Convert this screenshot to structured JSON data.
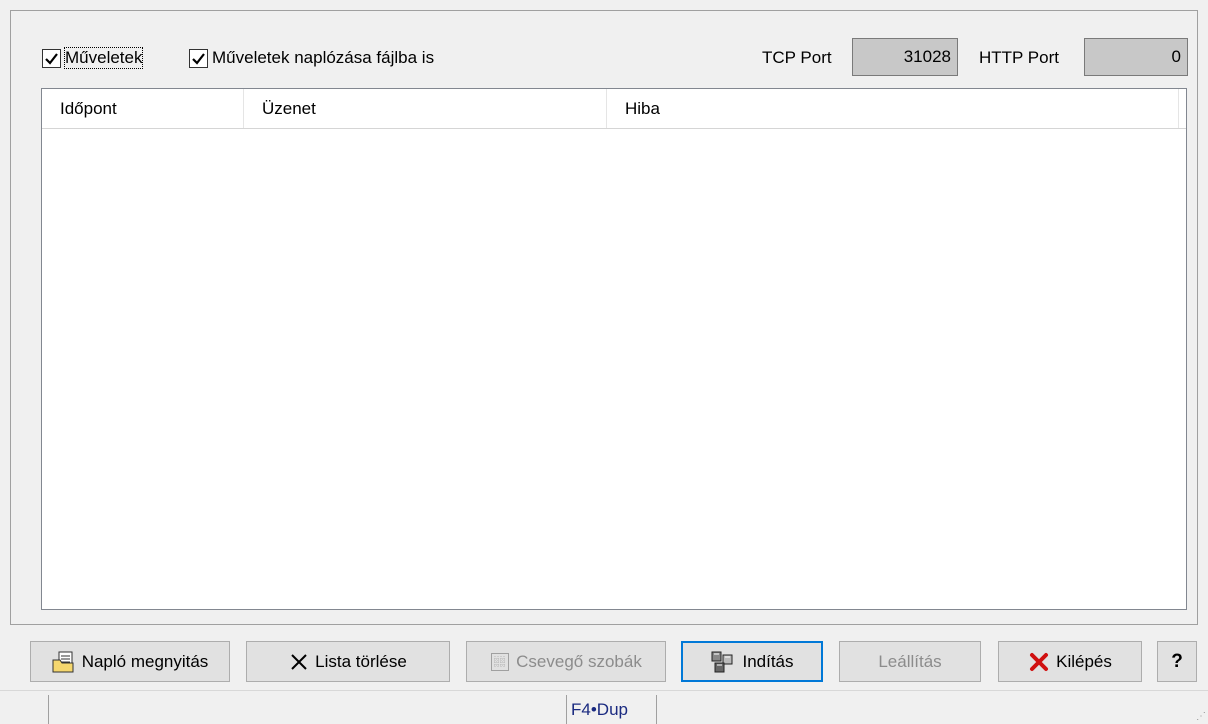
{
  "options": {
    "muveletek_label": "Műveletek",
    "muveletek_checked": true,
    "naplozas_label": "Műveletek naplózása fájlba is",
    "naplozas_checked": true,
    "tcp_port_label": "TCP Port",
    "tcp_port_value": "31028",
    "http_port_label": "HTTP Port",
    "http_port_value": "0"
  },
  "list": {
    "columns": [
      "Időpont",
      "Üzenet",
      "Hiba"
    ],
    "rows": []
  },
  "buttons": {
    "naplo": "Napló megnyitás",
    "torles": "Lista törlése",
    "csevego": "Csevegő szobák",
    "inditas": "Indítás",
    "leallitas": "Leállítás",
    "kilepes": "Kilépés",
    "help": "?"
  },
  "statusbar": {
    "cell2": "F4•Dup"
  },
  "colors": {
    "accent": "#0078d7",
    "exit_icon": "#d01010"
  }
}
